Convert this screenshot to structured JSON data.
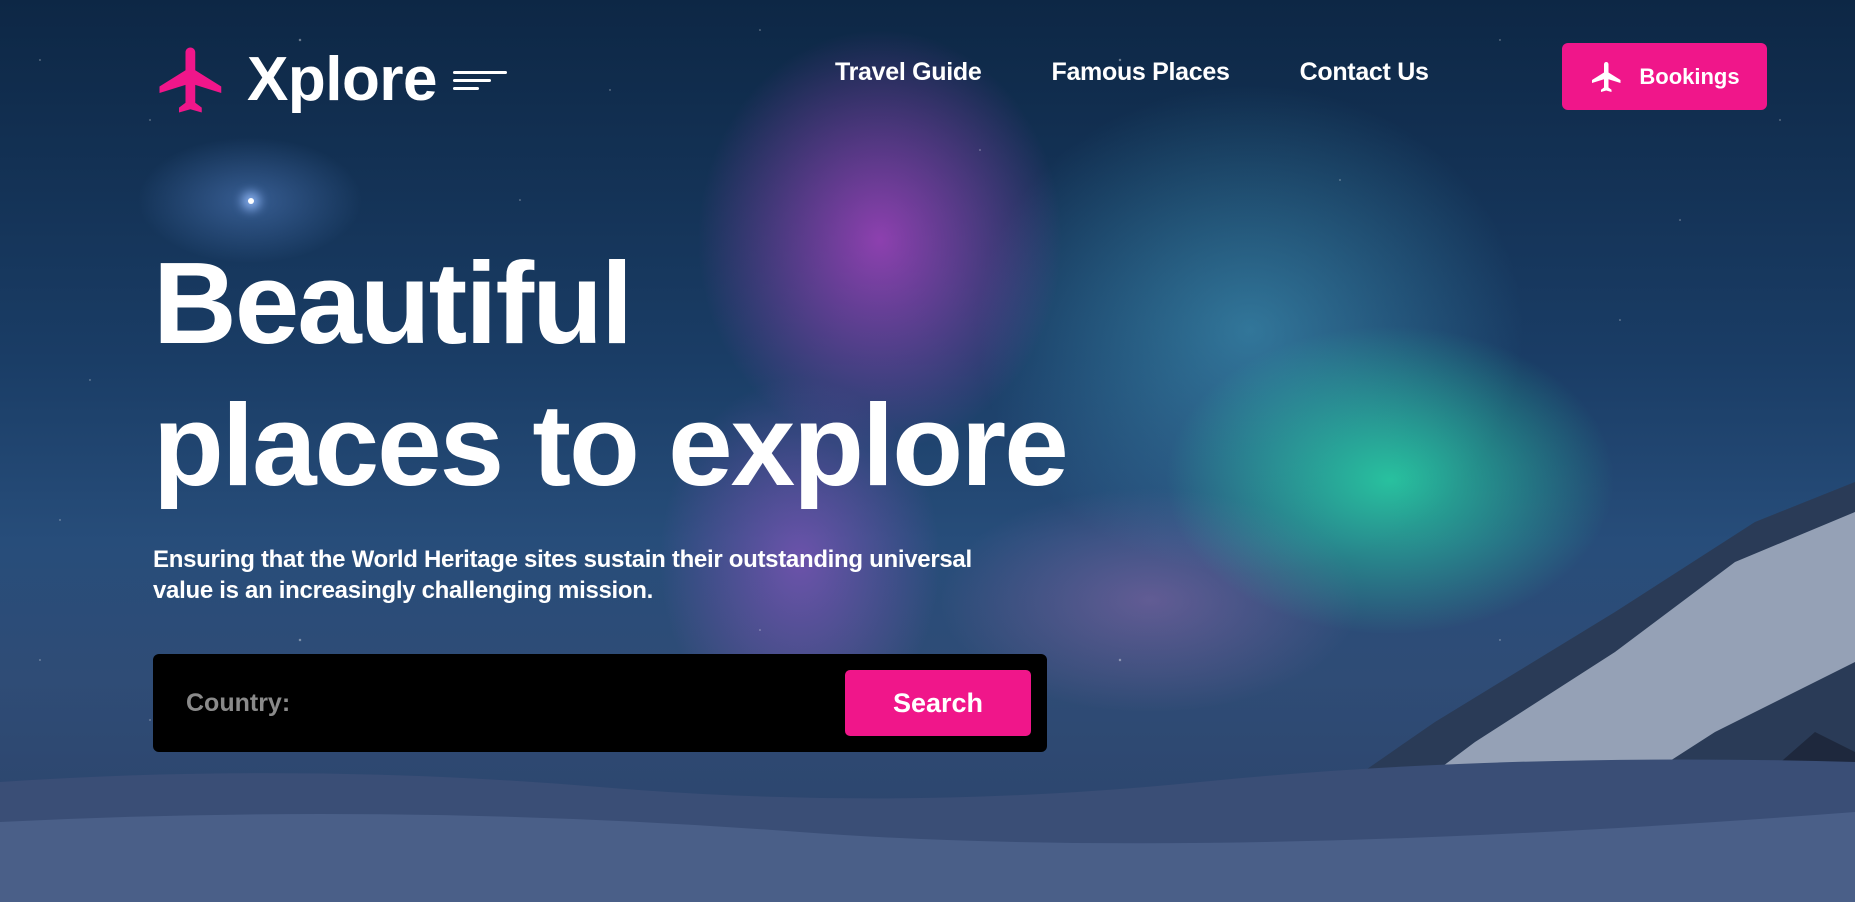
{
  "brand": {
    "name": "Xplore",
    "accent_color": "#f0168a",
    "icon": "airplane-icon"
  },
  "nav": {
    "items": [
      {
        "label": "Travel Guide"
      },
      {
        "label": "Famous Places"
      },
      {
        "label": "Contact Us"
      }
    ],
    "bookings_label": "Bookings"
  },
  "hero": {
    "headline_line1": "Beautiful",
    "headline_line2": "places to explore",
    "subtext": "Ensuring that the World Heritage sites sustain their outstanding universal value is an increasingly challenging mission."
  },
  "search": {
    "label": "Country:",
    "value": "",
    "button_label": "Search"
  }
}
